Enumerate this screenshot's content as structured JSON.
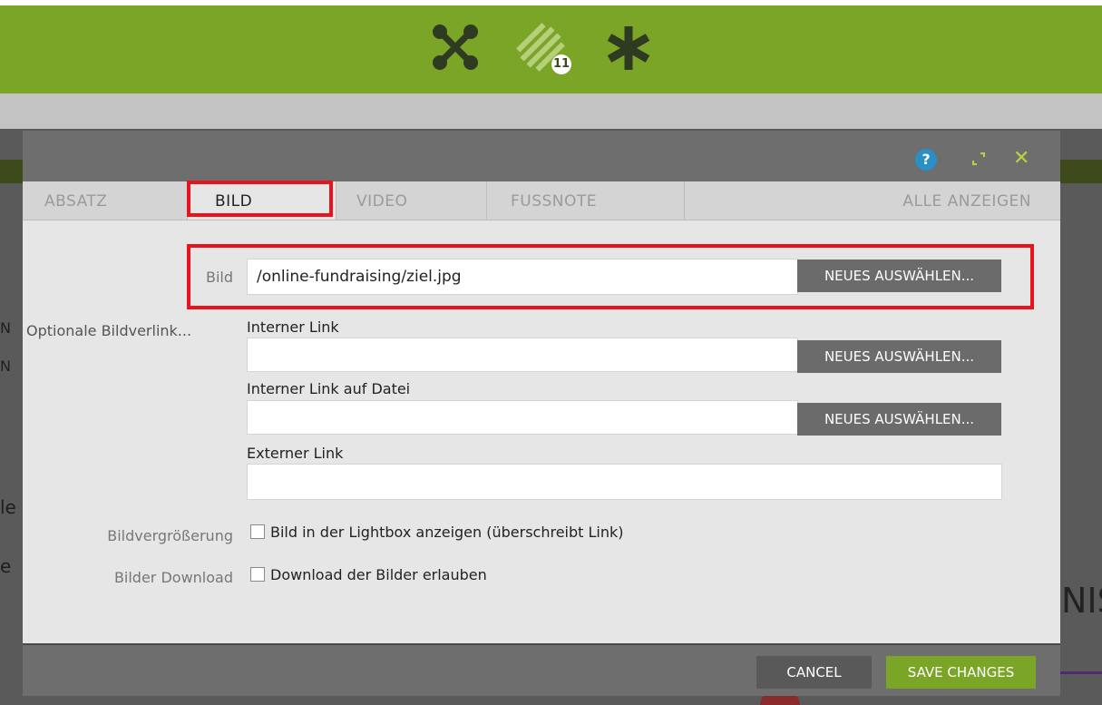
{
  "topbar": {
    "icons": [
      "network-icon",
      "pattern-icon",
      "asterisk-icon"
    ],
    "badge_count": "11"
  },
  "background": {
    "text_left_1": "N",
    "text_left_2": "N",
    "text_left_3": "le",
    "text_left_4": "e",
    "text_right": "NIS"
  },
  "modal": {
    "help_label": "?",
    "close_label": "✕",
    "tabs": [
      {
        "label": "ABSATZ"
      },
      {
        "label": "BILD"
      },
      {
        "label": "VIDEO"
      },
      {
        "label": "FUSSNOTE"
      },
      {
        "label": "ALLE ANZEIGEN"
      }
    ],
    "active_tab": "BILD",
    "form": {
      "bild_label": "Bild",
      "bild_value": "/online-fundraising/ziel.jpg",
      "select_label": "NEUES AUSWÄHLEN...",
      "optional_label": "Optionale Bildverlink...",
      "internal_link_title": "Interner Link",
      "internal_link_value": "",
      "internal_file_title": "Interner Link auf Datei",
      "internal_file_value": "",
      "external_link_title": "Externer Link",
      "external_link_value": "",
      "zoom_label": "Bildvergrößerung",
      "zoom_checkbox": "Bild in der Lightbox anzeigen (überschreibt Link)",
      "download_label": "Bilder Download",
      "download_checkbox": "Download der Bilder erlauben"
    },
    "footer": {
      "cancel_label": "CANCEL",
      "save_label": "SAVE CHANGES"
    }
  },
  "colors": {
    "brand_green": "#7aa526",
    "highlight_red": "#e8141b",
    "help_blue": "#2a8fc4"
  }
}
